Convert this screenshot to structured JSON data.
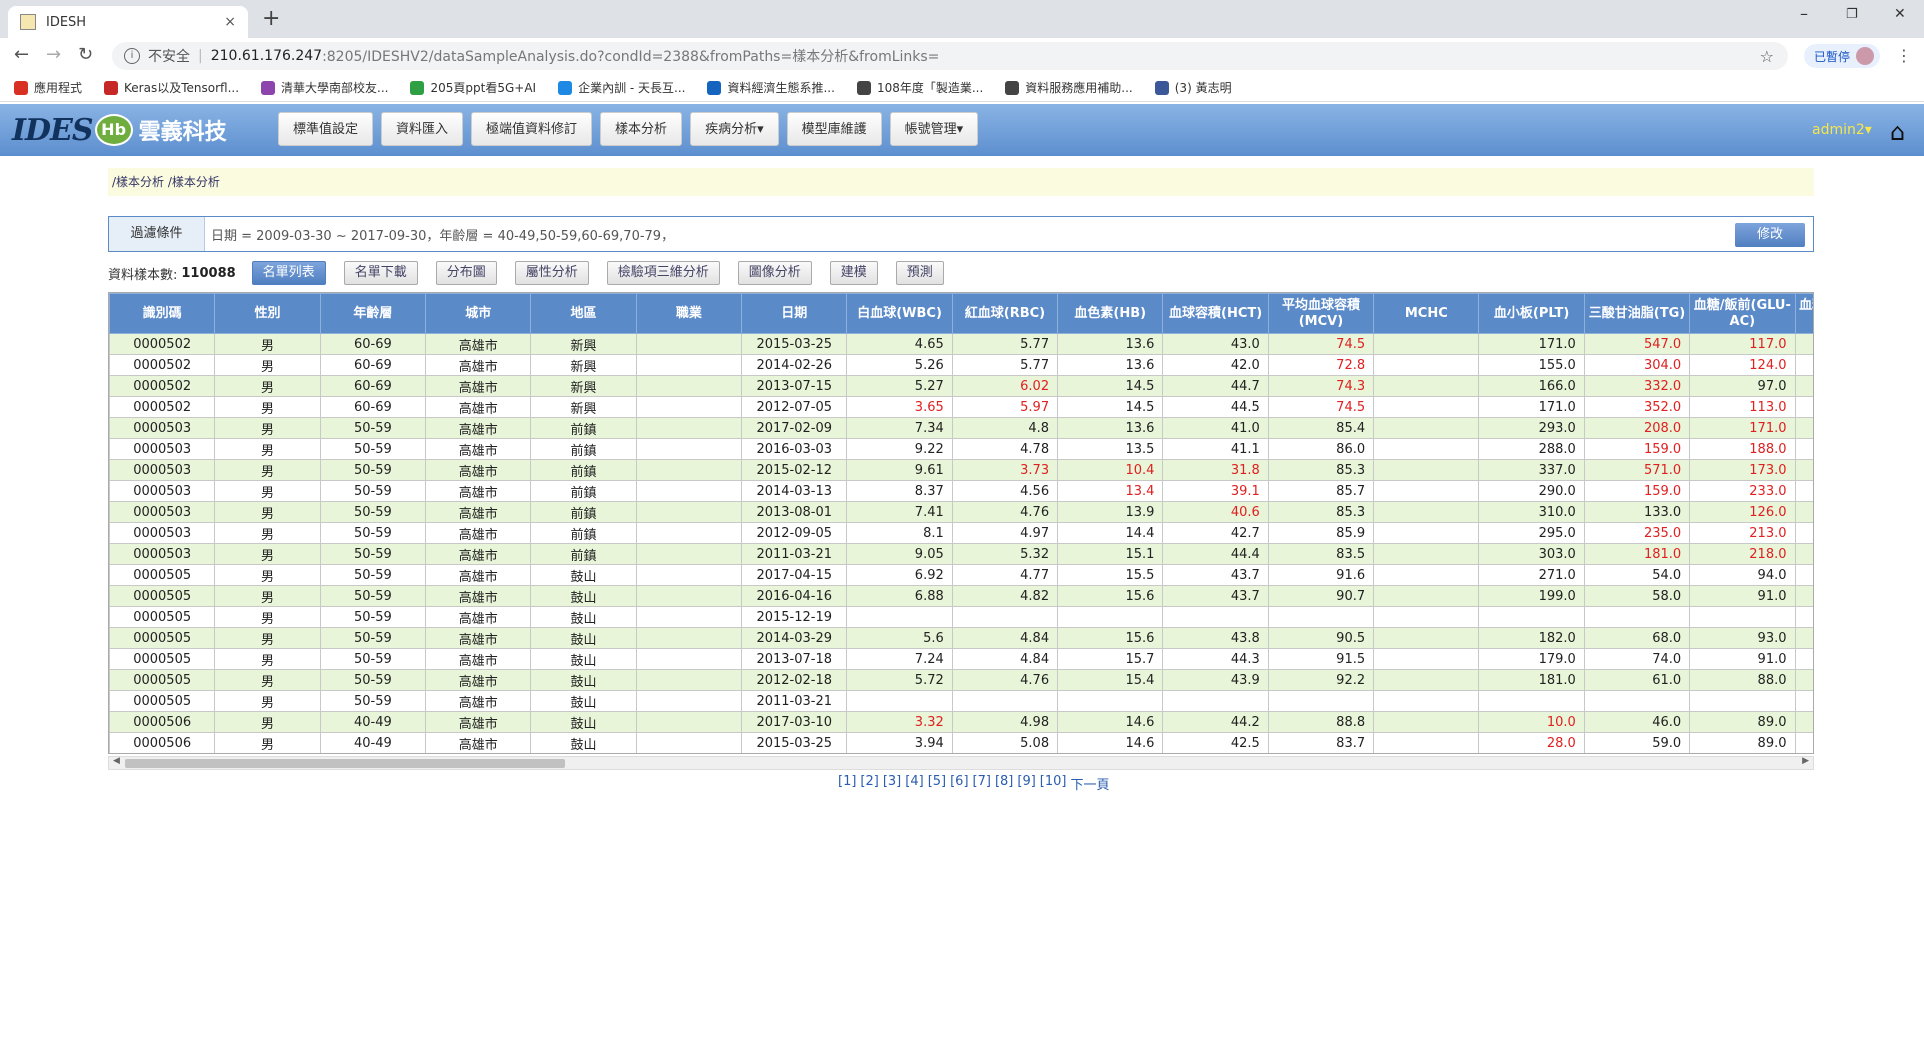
{
  "browser": {
    "tab_title": "IDESH",
    "tab_close": "×",
    "new_tab": "+",
    "min": "–",
    "restore": "❐",
    "close": "✕",
    "url_insecure": "不安全",
    "url_host": "210.61.176.247",
    "url_path": ":8205/IDESHV2/dataSampleAnalysis.do?condId=2388&fromPaths=樣本分析&fromLinks=",
    "paused": "已暫停",
    "bookmarks": [
      {
        "label": "應用程式",
        "color": "#d93025"
      },
      {
        "label": "Keras以及Tensorfl...",
        "color": "#c62828"
      },
      {
        "label": "清華大學南部校友...",
        "color": "#8e44ad"
      },
      {
        "label": "205頁ppt看5G+AI",
        "color": "#2ea043"
      },
      {
        "label": "企業內訓 - 天長互...",
        "color": "#1e88e5"
      },
      {
        "label": "資料經濟生態系推...",
        "color": "#1565c0"
      },
      {
        "label": "108年度「製造業...",
        "color": "#444444"
      },
      {
        "label": "資料服務應用補助...",
        "color": "#444444"
      },
      {
        "label": "(3) 黃志明",
        "color": "#3b5998"
      }
    ]
  },
  "app": {
    "logo_text": "IDES",
    "logo_mark": "Hb",
    "brand": "雲義科技",
    "nav": [
      "標準值設定",
      "資料匯入",
      "極端值資料修訂",
      "樣本分析",
      "疾病分析▾",
      "模型庫維護",
      "帳號管理▾"
    ],
    "user": "admin2▾",
    "home_icon": "⌂"
  },
  "breadcrumb": "/樣本分析 /樣本分析",
  "filter": {
    "label": "過濾條件",
    "text": "日期 = 2009-03-30 ~ 2017-09-30，年齡層 = 40-49,50-59,60-69,70-79，",
    "edit": "修改"
  },
  "actions": {
    "count_label": "資料樣本數:",
    "count": "110088",
    "buttons": [
      "名單列表",
      "名單下載",
      "分布圖",
      "屬性分析",
      "檢驗項三維分析",
      "圖像分析",
      "建模",
      "預測"
    ]
  },
  "table": {
    "headers": [
      "識別碼",
      "性別",
      "年齡層",
      "城市",
      "地區",
      "職業",
      "日期",
      "白血球(WBC)",
      "紅血球(RBC)",
      "血色素(HB)",
      "血球容積(HCT)",
      "平均血球容積(MCV)",
      "MCHC",
      "血小板(PLT)",
      "三酸甘油脂(TG)",
      "血糖/飯前(GLU-AC)",
      "血糖/飯後(GLU-PC)"
    ],
    "rows": [
      [
        "0000502",
        "男",
        "60-69",
        "高雄市",
        "新興",
        "",
        "2015-03-25",
        "4.65",
        "5.77",
        "13.6",
        "43.0",
        "74.5",
        "",
        "171.0",
        "547.0",
        "117.0",
        ""
      ],
      [
        "0000502",
        "男",
        "60-69",
        "高雄市",
        "新興",
        "",
        "2014-02-26",
        "5.26",
        "5.77",
        "13.6",
        "42.0",
        "72.8",
        "",
        "155.0",
        "304.0",
        "124.0",
        ""
      ],
      [
        "0000502",
        "男",
        "60-69",
        "高雄市",
        "新興",
        "",
        "2013-07-15",
        "5.27",
        "6.02",
        "14.5",
        "44.7",
        "74.3",
        "",
        "166.0",
        "332.0",
        "97.0",
        ""
      ],
      [
        "0000502",
        "男",
        "60-69",
        "高雄市",
        "新興",
        "",
        "2012-07-05",
        "3.65",
        "5.97",
        "14.5",
        "44.5",
        "74.5",
        "",
        "171.0",
        "352.0",
        "113.0",
        ""
      ],
      [
        "0000503",
        "男",
        "50-59",
        "高雄市",
        "前鎮",
        "",
        "2017-02-09",
        "7.34",
        "4.8",
        "13.6",
        "41.0",
        "85.4",
        "",
        "293.0",
        "208.0",
        "171.0",
        ""
      ],
      [
        "0000503",
        "男",
        "50-59",
        "高雄市",
        "前鎮",
        "",
        "2016-03-03",
        "9.22",
        "4.78",
        "13.5",
        "41.1",
        "86.0",
        "",
        "288.0",
        "159.0",
        "188.0",
        ""
      ],
      [
        "0000503",
        "男",
        "50-59",
        "高雄市",
        "前鎮",
        "",
        "2015-02-12",
        "9.61",
        "3.73",
        "10.4",
        "31.8",
        "85.3",
        "",
        "337.0",
        "571.0",
        "173.0",
        ""
      ],
      [
        "0000503",
        "男",
        "50-59",
        "高雄市",
        "前鎮",
        "",
        "2014-03-13",
        "8.37",
        "4.56",
        "13.4",
        "39.1",
        "85.7",
        "",
        "290.0",
        "159.0",
        "233.0",
        ""
      ],
      [
        "0000503",
        "男",
        "50-59",
        "高雄市",
        "前鎮",
        "",
        "2013-08-01",
        "7.41",
        "4.76",
        "13.9",
        "40.6",
        "85.3",
        "",
        "310.0",
        "133.0",
        "126.0",
        ""
      ],
      [
        "0000503",
        "男",
        "50-59",
        "高雄市",
        "前鎮",
        "",
        "2012-09-05",
        "8.1",
        "4.97",
        "14.4",
        "42.7",
        "85.9",
        "",
        "295.0",
        "235.0",
        "213.0",
        ""
      ],
      [
        "0000503",
        "男",
        "50-59",
        "高雄市",
        "前鎮",
        "",
        "2011-03-21",
        "9.05",
        "5.32",
        "15.1",
        "44.4",
        "83.5",
        "",
        "303.0",
        "181.0",
        "218.0",
        ""
      ],
      [
        "0000505",
        "男",
        "50-59",
        "高雄市",
        "鼓山",
        "",
        "2017-04-15",
        "6.92",
        "4.77",
        "15.5",
        "43.7",
        "91.6",
        "",
        "271.0",
        "54.0",
        "94.0",
        ""
      ],
      [
        "0000505",
        "男",
        "50-59",
        "高雄市",
        "鼓山",
        "",
        "2016-04-16",
        "6.88",
        "4.82",
        "15.6",
        "43.7",
        "90.7",
        "",
        "199.0",
        "58.0",
        "91.0",
        ""
      ],
      [
        "0000505",
        "男",
        "50-59",
        "高雄市",
        "鼓山",
        "",
        "2015-12-19",
        "",
        "",
        "",
        "",
        "",
        "",
        "",
        "",
        "",
        ""
      ],
      [
        "0000505",
        "男",
        "50-59",
        "高雄市",
        "鼓山",
        "",
        "2014-03-29",
        "5.6",
        "4.84",
        "15.6",
        "43.8",
        "90.5",
        "",
        "182.0",
        "68.0",
        "93.0",
        ""
      ],
      [
        "0000505",
        "男",
        "50-59",
        "高雄市",
        "鼓山",
        "",
        "2013-07-18",
        "7.24",
        "4.84",
        "15.7",
        "44.3",
        "91.5",
        "",
        "179.0",
        "74.0",
        "91.0",
        ""
      ],
      [
        "0000505",
        "男",
        "50-59",
        "高雄市",
        "鼓山",
        "",
        "2012-02-18",
        "5.72",
        "4.76",
        "15.4",
        "43.9",
        "92.2",
        "",
        "181.0",
        "61.0",
        "88.0",
        ""
      ],
      [
        "0000505",
        "男",
        "50-59",
        "高雄市",
        "鼓山",
        "",
        "2011-03-21",
        "",
        "",
        "",
        "",
        "",
        "",
        "",
        "",
        "",
        ""
      ],
      [
        "0000506",
        "男",
        "40-49",
        "高雄市",
        "鼓山",
        "",
        "2017-03-10",
        "3.32",
        "4.98",
        "14.6",
        "44.2",
        "88.8",
        "",
        "10.0",
        "46.0",
        "89.0",
        ""
      ],
      [
        "0000506",
        "男",
        "40-49",
        "高雄市",
        "鼓山",
        "",
        "2015-03-25",
        "3.94",
        "5.08",
        "14.6",
        "42.5",
        "83.7",
        "",
        "28.0",
        "59.0",
        "89.0",
        ""
      ]
    ],
    "abnormal": [
      [
        0,
        11
      ],
      [
        0,
        14
      ],
      [
        0,
        15
      ],
      [
        1,
        11
      ],
      [
        1,
        14
      ],
      [
        1,
        15
      ],
      [
        2,
        8
      ],
      [
        2,
        11
      ],
      [
        2,
        14
      ],
      [
        3,
        7
      ],
      [
        3,
        8
      ],
      [
        3,
        11
      ],
      [
        3,
        14
      ],
      [
        3,
        15
      ],
      [
        4,
        14
      ],
      [
        4,
        15
      ],
      [
        5,
        14
      ],
      [
        5,
        15
      ],
      [
        6,
        8
      ],
      [
        6,
        9
      ],
      [
        6,
        10
      ],
      [
        6,
        14
      ],
      [
        6,
        15
      ],
      [
        7,
        9
      ],
      [
        7,
        10
      ],
      [
        7,
        14
      ],
      [
        7,
        15
      ],
      [
        8,
        10
      ],
      [
        8,
        15
      ],
      [
        9,
        14
      ],
      [
        9,
        15
      ],
      [
        10,
        14
      ],
      [
        10,
        15
      ],
      [
        18,
        7
      ],
      [
        18,
        13
      ],
      [
        19,
        13
      ]
    ],
    "abnormal_color": "#e02020"
  },
  "pager": {
    "pages": [
      "[1]",
      "[2]",
      "[3]",
      "[4]",
      "[5]",
      "[6]",
      "[7]",
      "[8]",
      "[9]",
      "[10]"
    ],
    "next": "下一頁"
  }
}
